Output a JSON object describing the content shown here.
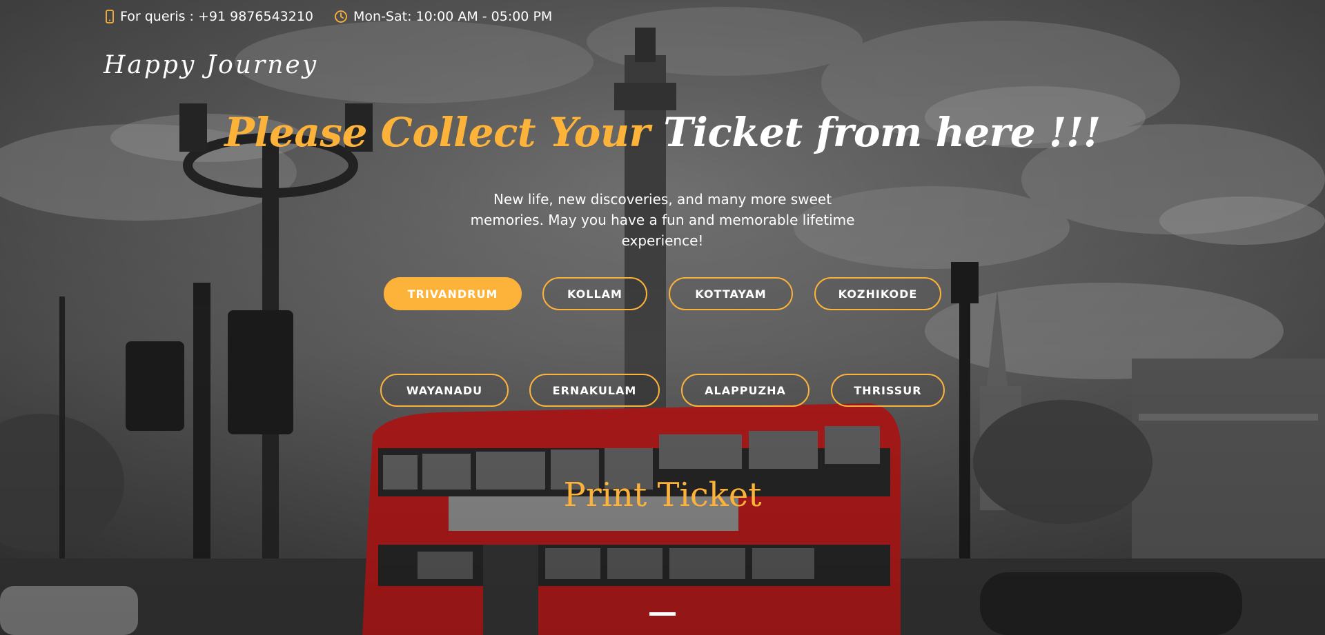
{
  "topbar": {
    "phone_text": "For queris : +91 9876543210",
    "hours_text": "Mon-Sat: 10:00 AM - 05:00 PM",
    "phone_icon": "mobile-phone-icon",
    "hours_icon": "clock-icon"
  },
  "logo": {
    "text": "Happy Journey"
  },
  "hero": {
    "headline_accent": "Please Collect Your",
    "headline_rest": " Ticket from here !!!",
    "subtext": "New life, new discoveries, and many more sweet memories. May you have a fun and memorable lifetime experience!"
  },
  "cities": {
    "row1": [
      "TRIVANDRUM",
      "KOLLAM",
      "KOTTAYAM",
      "KOZHIKODE"
    ],
    "row2": [
      "WAYANADU",
      "ERNAKULAM",
      "ALAPPUZHA",
      "THRISSUR"
    ],
    "active": "TRIVANDRUM"
  },
  "print_ticket": {
    "label": "Print Ticket"
  },
  "colors": {
    "accent": "#fdb33a",
    "text": "#ffffff"
  }
}
